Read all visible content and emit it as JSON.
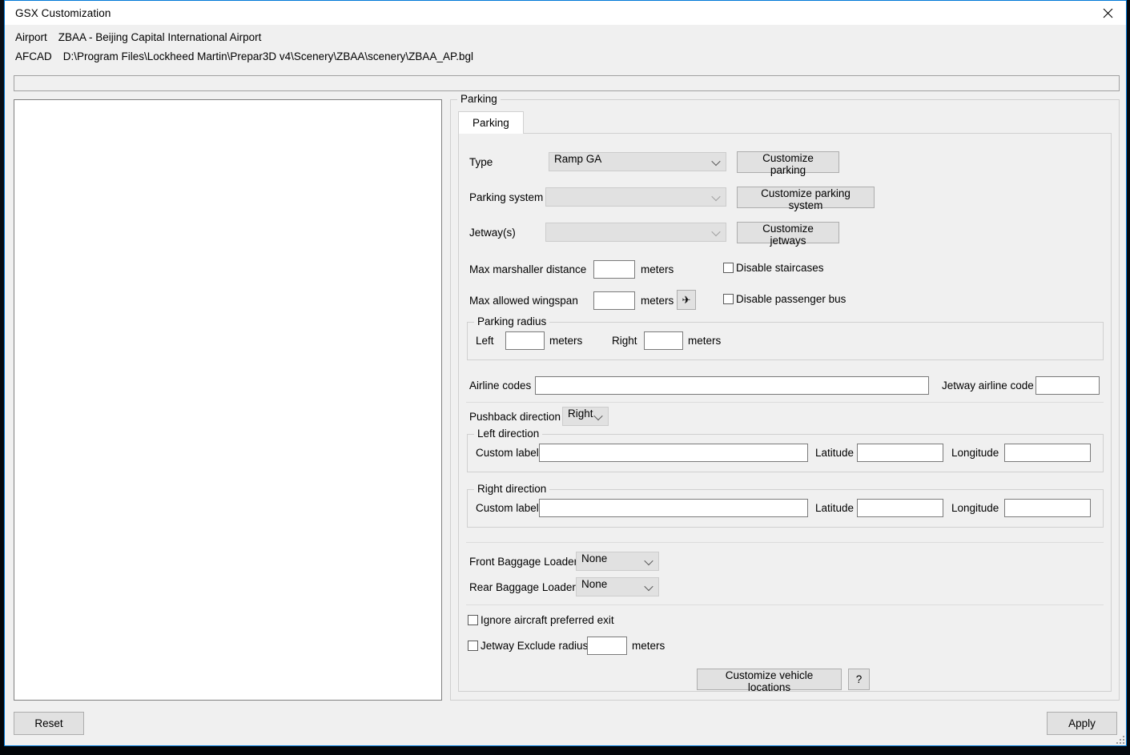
{
  "window": {
    "title": "GSX Customization",
    "close_icon": "close-icon"
  },
  "header": {
    "airport_label": "Airport",
    "airport_value": "ZBAA - Beijing Capital International Airport",
    "afcad_label": "AFCAD",
    "afcad_value": "D:\\Program Files\\Lockheed Martin\\Prepar3D v4\\Scenery\\ZBAA\\scenery\\ZBAA_AP.bgl",
    "status_text": ""
  },
  "parking_group": {
    "title": "Parking",
    "tab_label": "Parking"
  },
  "form": {
    "type_label": "Type",
    "type_value": "Ramp GA",
    "customize_parking": "Customize parking",
    "parking_system_label": "Parking system",
    "parking_system_value": "",
    "customize_parking_system": "Customize parking system",
    "jetways_label": "Jetway(s)",
    "jetways_value": "",
    "customize_jetways": "Customize jetways",
    "max_marshaller_label": "Max marshaller distance",
    "max_marshaller_value": "",
    "max_marshaller_units": "meters",
    "max_wingspan_label": "Max allowed wingspan",
    "max_wingspan_value": "",
    "max_wingspan_units": "meters",
    "wingspan_aircraft_icon": "airplane-icon",
    "disable_staircases_label": "Disable staircases",
    "disable_staircases_checked": false,
    "disable_passenger_bus_label": "Disable passenger bus",
    "disable_passenger_bus_checked": false,
    "parking_radius_title": "Parking radius",
    "radius_left_label": "Left",
    "radius_left_value": "",
    "radius_left_units": "meters",
    "radius_right_label": "Right",
    "radius_right_value": "",
    "radius_right_units": "meters",
    "airline_codes_label": "Airline codes",
    "airline_codes_value": "",
    "jetway_airline_code_label": "Jetway airline code",
    "jetway_airline_code_value": "",
    "pushback_label": "Pushback direction",
    "pushback_value": "Right",
    "left_direction_title": "Left direction",
    "left_custom_label": "Custom label",
    "left_custom_value": "",
    "left_lat_label": "Latitude",
    "left_lat_value": "",
    "left_lon_label": "Longitude",
    "left_lon_value": "",
    "right_direction_title": "Right direction",
    "right_custom_label": "Custom label",
    "right_custom_value": "",
    "right_lat_label": "Latitude",
    "right_lat_value": "",
    "right_lon_label": "Longitude",
    "right_lon_value": "",
    "front_baggage_label": "Front Baggage Loader",
    "front_baggage_value": "None",
    "rear_baggage_label": "Rear Baggage Loader",
    "rear_baggage_value": "None",
    "ignore_exit_label": "Ignore aircraft preferred exit",
    "ignore_exit_checked": false,
    "jetway_exclude_label": "Jetway Exclude radius",
    "jetway_exclude_checked": false,
    "jetway_exclude_value": "",
    "jetway_exclude_units": "meters",
    "customize_vehicle_locations": "Customize vehicle locations",
    "help_button": "?"
  },
  "footer": {
    "reset_label": "Reset",
    "apply_label": "Apply"
  }
}
